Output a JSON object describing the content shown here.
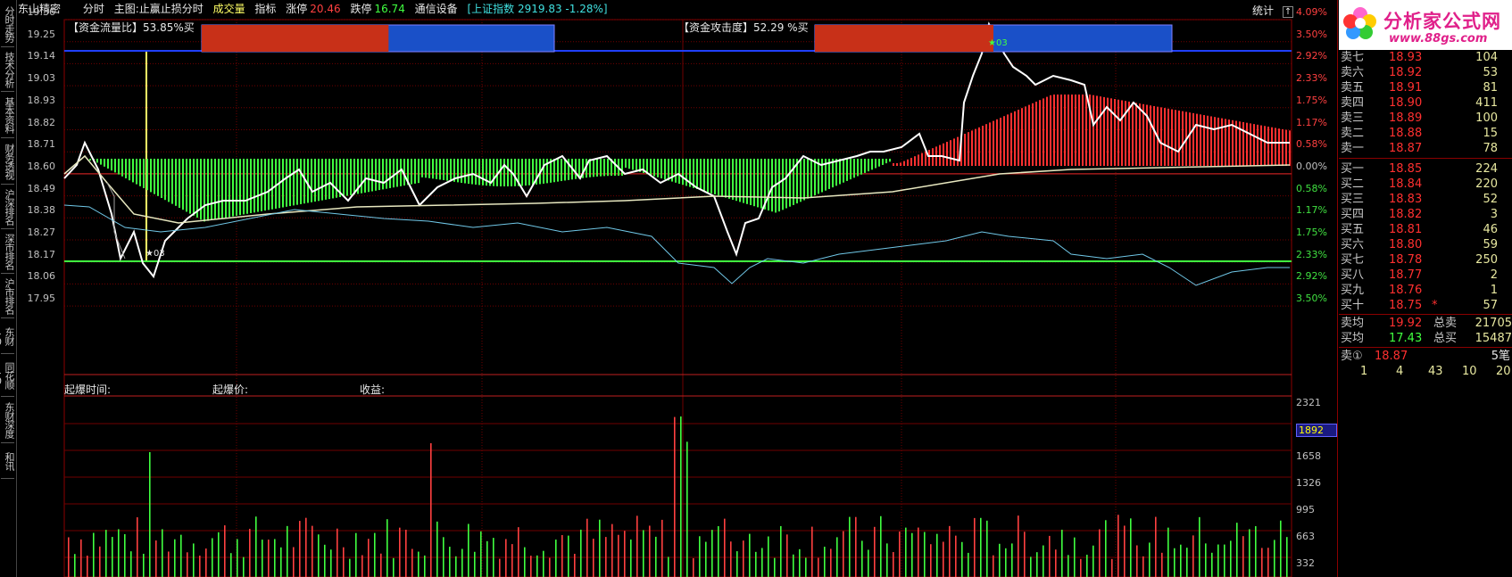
{
  "sidebar": {
    "tabs": [
      "分时走势",
      "技术分析",
      "基本资料",
      "财务透视",
      "沪深排名",
      "深市排名",
      "沪市排名",
      "东财10",
      "同花顺10",
      "东财深度",
      "和讯"
    ]
  },
  "header": {
    "stock_name": "东山精密",
    "view_mode": "分时",
    "main_chart": "主图:止赢止损分时",
    "volume_label": "成交量",
    "indicator_label": "指标",
    "limit_up_label": "涨停",
    "limit_up_value": "20.46",
    "limit_down_label": "跌停",
    "limit_down_value": "16.74",
    "sector": "通信设备",
    "index_info": "[上证指数 2919.83 -1.28%]",
    "stats_label": "统计",
    "stats_arrow": "↑"
  },
  "panels": {
    "flow_ratio_label": "【资金流量比】53.85%买",
    "attack_label": "【资金攻击度】52.29 %买",
    "flow_ratio_red_pct": 0.53,
    "attack_red_pct": 0.5,
    "point_label_1": "★03",
    "point_label_2": "★03"
  },
  "axis_left": [
    "19.36",
    "19.25",
    "19.14",
    "19.03",
    "18.93",
    "18.82",
    "18.71",
    "18.60",
    "18.49",
    "18.38",
    "18.27",
    "18.17",
    "18.06",
    "17.95"
  ],
  "axis_right": [
    "4.09%",
    "3.50%",
    "2.92%",
    "2.33%",
    "1.75%",
    "1.17%",
    "0.58%",
    "0.00%",
    "0.58%",
    "1.17%",
    "1.75%",
    "2.33%",
    "2.92%",
    "3.50%"
  ],
  "volume_axis": [
    "2321",
    "1892",
    "1658",
    "1326",
    "995",
    "663",
    "332"
  ],
  "volume_axis_highlight": "1892",
  "lower_labels": {
    "time": "起爆时间:",
    "price": "起爆价:",
    "profit": "收益:"
  },
  "order_book": {
    "sells": [
      {
        "label": "卖七",
        "price": "18.93",
        "vol": "104"
      },
      {
        "label": "卖六",
        "price": "18.92",
        "vol": "53"
      },
      {
        "label": "卖五",
        "price": "18.91",
        "vol": "81"
      },
      {
        "label": "卖四",
        "price": "18.90",
        "vol": "411"
      },
      {
        "label": "卖三",
        "price": "18.89",
        "vol": "100"
      },
      {
        "label": "卖二",
        "price": "18.88",
        "vol": "15"
      },
      {
        "label": "卖一",
        "price": "18.87",
        "vol": "78"
      }
    ],
    "buys": [
      {
        "label": "买一",
        "price": "18.85",
        "vol": "224"
      },
      {
        "label": "买二",
        "price": "18.84",
        "vol": "220"
      },
      {
        "label": "买三",
        "price": "18.83",
        "vol": "52"
      },
      {
        "label": "买四",
        "price": "18.82",
        "vol": "3"
      },
      {
        "label": "买五",
        "price": "18.81",
        "vol": "46"
      },
      {
        "label": "买六",
        "price": "18.80",
        "vol": "59"
      },
      {
        "label": "买七",
        "price": "18.78",
        "vol": "250"
      },
      {
        "label": "买八",
        "price": "18.77",
        "vol": "2"
      },
      {
        "label": "买九",
        "price": "18.76",
        "vol": "1"
      },
      {
        "label": "买十",
        "price": "18.75",
        "vol": "57",
        "mark": "*"
      }
    ],
    "sell_avg_label": "卖均",
    "sell_avg": "19.92",
    "total_sell_label": "总卖",
    "total_sell": "21705",
    "buy_avg_label": "买均",
    "buy_avg": "17.43",
    "total_buy_label": "总买",
    "total_buy": "15487",
    "queue_label": "卖①",
    "queue_price": "18.87",
    "queue_count": "5笔",
    "queue_values": [
      "1",
      "4",
      "43",
      "10",
      "20"
    ]
  },
  "brand": {
    "name": "分析家公式网",
    "url": "www.88gs.com"
  },
  "colors": {
    "up": "#ff3030",
    "down": "#40ff40",
    "grid": "#8b0000",
    "yellow": "#ffff66"
  }
}
